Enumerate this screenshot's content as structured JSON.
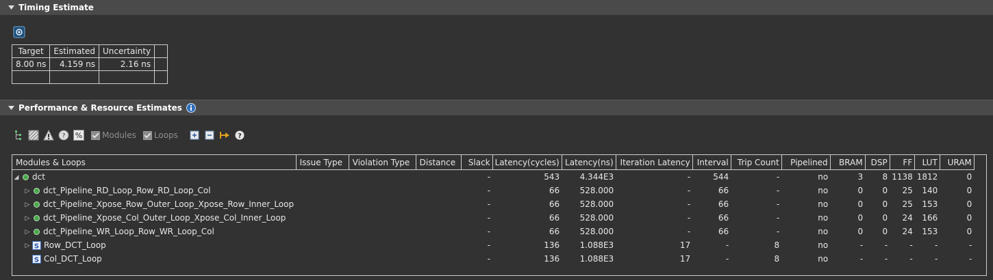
{
  "timing_section": {
    "title": "Timing Estimate",
    "table": {
      "headers": [
        "Target",
        "Estimated",
        "Uncertainty"
      ],
      "rows": [
        [
          "8.00 ns",
          "4.159 ns",
          "2.16 ns"
        ]
      ]
    }
  },
  "perf_section": {
    "title": "Performance & Resource Estimates",
    "toolbar": {
      "modules_label": "Modules",
      "loops_label": "Loops"
    },
    "columns": [
      "Modules & Loops",
      "Issue Type",
      "Violation Type",
      "Distance",
      "Slack",
      "Latency(cycles)",
      "Latency(ns)",
      "Iteration Latency",
      "Interval",
      "Trip Count",
      "Pipelined",
      "BRAM",
      "DSP",
      "FF",
      "LUT",
      "URAM"
    ],
    "rows": [
      {
        "name": "dct",
        "slack": "-",
        "lat_cycles": "543",
        "lat_ns": "4.344E3",
        "iter_lat": "-",
        "interval": "544",
        "trip": "-",
        "pipelined": "no",
        "bram": "3",
        "dsp": "8",
        "ff": "1138",
        "lut": "1812",
        "uram": "0"
      },
      {
        "name": "dct_Pipeline_RD_Loop_Row_RD_Loop_Col",
        "slack": "-",
        "lat_cycles": "66",
        "lat_ns": "528.000",
        "iter_lat": "-",
        "interval": "66",
        "trip": "-",
        "pipelined": "no",
        "bram": "0",
        "dsp": "0",
        "ff": "25",
        "lut": "140",
        "uram": "0"
      },
      {
        "name": "dct_Pipeline_Xpose_Row_Outer_Loop_Xpose_Row_Inner_Loop",
        "slack": "-",
        "lat_cycles": "66",
        "lat_ns": "528.000",
        "iter_lat": "-",
        "interval": "66",
        "trip": "-",
        "pipelined": "no",
        "bram": "0",
        "dsp": "0",
        "ff": "25",
        "lut": "153",
        "uram": "0"
      },
      {
        "name": "dct_Pipeline_Xpose_Col_Outer_Loop_Xpose_Col_Inner_Loop",
        "slack": "-",
        "lat_cycles": "66",
        "lat_ns": "528.000",
        "iter_lat": "-",
        "interval": "66",
        "trip": "-",
        "pipelined": "no",
        "bram": "0",
        "dsp": "0",
        "ff": "24",
        "lut": "166",
        "uram": "0"
      },
      {
        "name": "dct_Pipeline_WR_Loop_Row_WR_Loop_Col",
        "slack": "-",
        "lat_cycles": "66",
        "lat_ns": "528.000",
        "iter_lat": "-",
        "interval": "66",
        "trip": "-",
        "pipelined": "no",
        "bram": "0",
        "dsp": "0",
        "ff": "24",
        "lut": "153",
        "uram": "0"
      },
      {
        "name": "Row_DCT_Loop",
        "slack": "-",
        "lat_cycles": "136",
        "lat_ns": "1.088E3",
        "iter_lat": "17",
        "interval": "-",
        "trip": "8",
        "pipelined": "no",
        "bram": "-",
        "dsp": "-",
        "ff": "-",
        "lut": "-",
        "uram": "-"
      },
      {
        "name": "Col_DCT_Loop",
        "slack": "-",
        "lat_cycles": "136",
        "lat_ns": "1.088E3",
        "iter_lat": "17",
        "interval": "-",
        "trip": "8",
        "pipelined": "no",
        "bram": "-",
        "dsp": "-",
        "ff": "-",
        "lut": "-",
        "uram": "-"
      }
    ]
  }
}
